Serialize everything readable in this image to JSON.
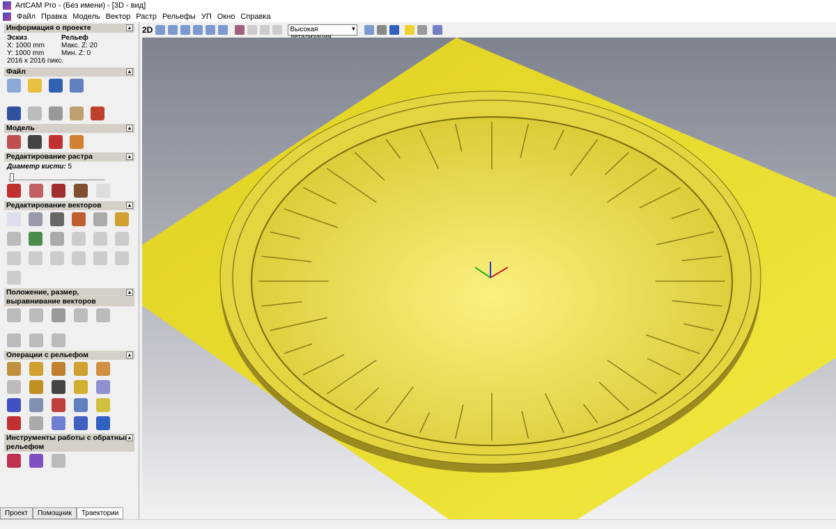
{
  "window": {
    "title": "ArtCAM Pro - (Без имени) - [3D - вид]"
  },
  "menu": [
    "Файл",
    "Правка",
    "Модель",
    "Вектор",
    "Растр",
    "Рельефы",
    "УП",
    "Окно",
    "Справка"
  ],
  "project_info": {
    "header": "Информация о проекте",
    "sketch_label": "Эскиз",
    "x": "X: 1000 mm",
    "y": "Y: 1000 mm",
    "pixels": "2016 x 2016 пикс.",
    "relief_label": "Рельеф",
    "max_z": "Макс. Z: 20",
    "min_z": "Мин. Z: 0"
  },
  "sections": {
    "file": "Файл",
    "model": "Модель",
    "raster": "Редактирование растра",
    "brush": "Диаметр кисти:",
    "brush_value": "5",
    "vectors": "Редактирование векторов",
    "position": "Положение, размер, выравнивание векторов",
    "relief_ops": "Операции с рельефом",
    "reverse": "Инструменты работы с обратным рельефом"
  },
  "toolbar": {
    "mode_2d": "2D",
    "detail": "Высокая детализация"
  },
  "tabs": [
    "Проект",
    "Помощник",
    "Траектории"
  ],
  "colors": {
    "relief": "#e8d830",
    "bg": "#8a8e9a"
  }
}
